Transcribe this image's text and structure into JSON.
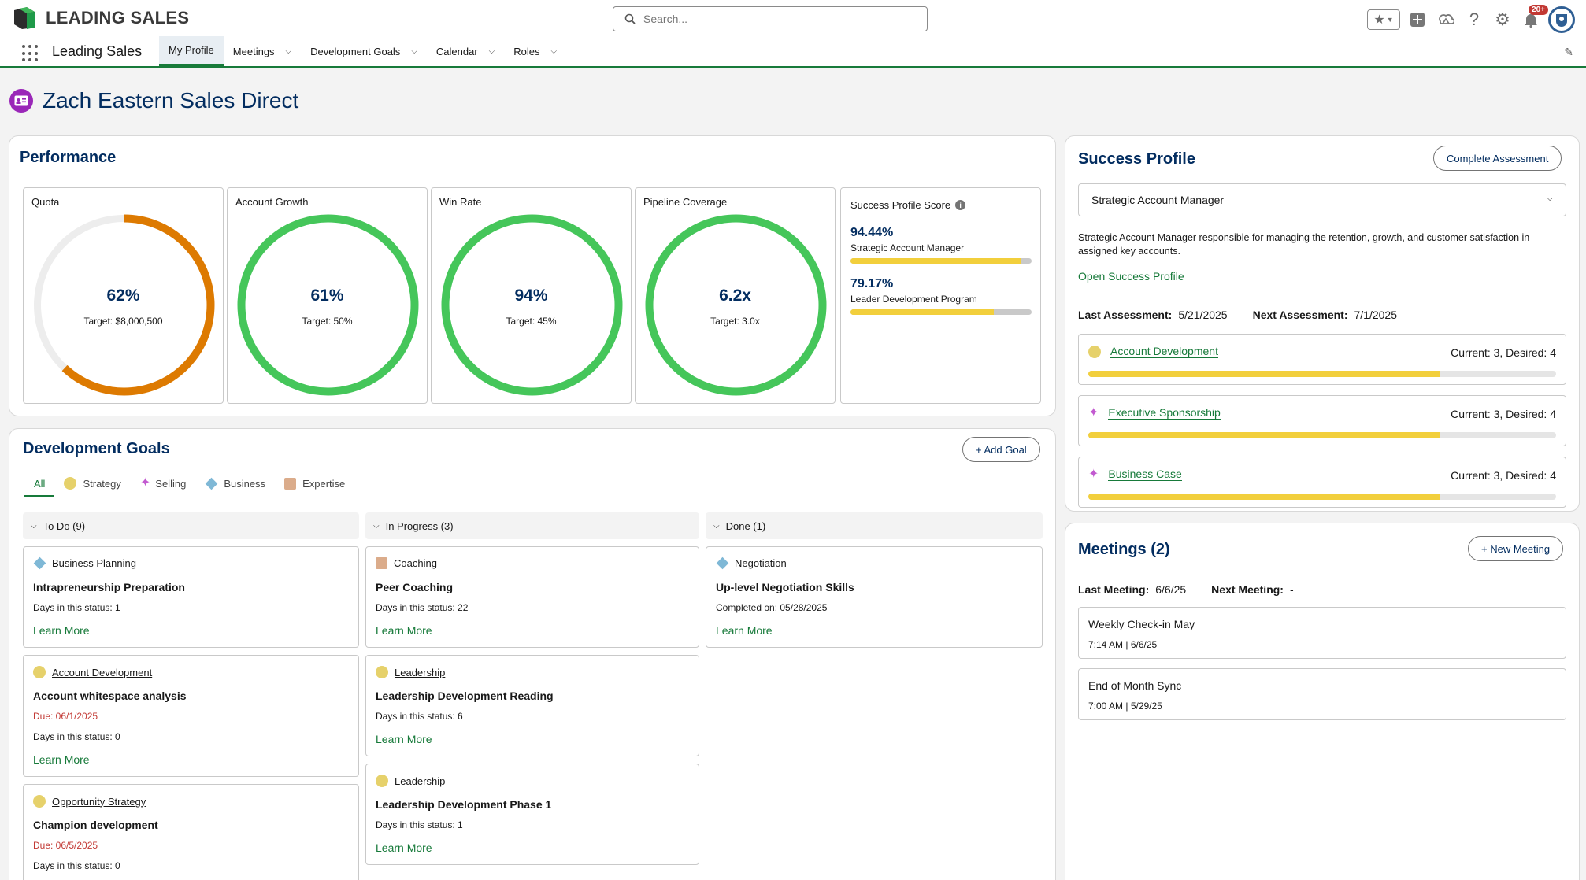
{
  "header": {
    "logo_text": "LEADING SALES",
    "search_placeholder": "Search...",
    "notification_badge": "20+"
  },
  "nav": {
    "app_name": "Leading Sales",
    "items": [
      {
        "label": "My Profile",
        "active": true,
        "has_menu": false
      },
      {
        "label": "Meetings",
        "active": false,
        "has_menu": true
      },
      {
        "label": "Development Goals",
        "active": false,
        "has_menu": true
      },
      {
        "label": "Calendar",
        "active": false,
        "has_menu": true
      },
      {
        "label": "Roles",
        "active": false,
        "has_menu": true
      }
    ]
  },
  "page": {
    "title": "Zach Eastern Sales Direct"
  },
  "performance": {
    "title": "Performance",
    "metrics": [
      {
        "label": "Quota",
        "value": "62%",
        "target": "Target: $8,000,500",
        "progress": 0.62,
        "color": "#dd7a01"
      },
      {
        "label": "Account Growth",
        "value": "61%",
        "target": "Target: 50%",
        "progress": 1.0,
        "color": "#45c65a"
      },
      {
        "label": "Win Rate",
        "value": "94%",
        "target": "Target: 45%",
        "progress": 1.0,
        "color": "#45c65a"
      },
      {
        "label": "Pipeline Coverage",
        "value": "6.2x",
        "target": "Target: 3.0x",
        "progress": 1.0,
        "color": "#45c65a"
      }
    ],
    "success_score": {
      "title": "Success Profile Score",
      "rows": [
        {
          "pct": "94.44%",
          "name": "Strategic Account Manager",
          "fill": 0.9444
        },
        {
          "pct": "79.17%",
          "name": "Leader Development Program",
          "fill": 0.7917
        }
      ]
    }
  },
  "dev_goals": {
    "title": "Development Goals",
    "add_label": "+ Add Goal",
    "filters": [
      "All",
      "Strategy",
      "Selling",
      "Business",
      "Expertise"
    ],
    "columns": [
      {
        "head": "To Do (9)",
        "goals": [
          {
            "category": "Business Planning",
            "icon": "diamond",
            "title": "Intrapreneurship Preparation",
            "due": "",
            "status": "Days in this status: 1",
            "link": "Learn More"
          },
          {
            "category": "Account Development",
            "icon": "dot",
            "title": "Account whitespace analysis",
            "due": "Due: 06/1/2025",
            "status": "Days in this status: 0",
            "link": "Learn More"
          },
          {
            "category": "Opportunity Strategy",
            "icon": "dot",
            "title": "Champion development",
            "due": "Due: 06/5/2025",
            "status": "Days in this status: 0",
            "link": ""
          }
        ]
      },
      {
        "head": "In Progress (3)",
        "goals": [
          {
            "category": "Coaching",
            "icon": "square",
            "title": "Peer Coaching",
            "due": "",
            "status": "Days in this status: 22",
            "link": "Learn More"
          },
          {
            "category": "Leadership",
            "icon": "dot",
            "title": "Leadership Development Reading",
            "due": "",
            "status": "Days in this status: 6",
            "link": "Learn More"
          },
          {
            "category": "Leadership",
            "icon": "dot",
            "title": "Leadership Development Phase 1",
            "due": "",
            "status": "Days in this status: 1",
            "link": "Learn More"
          }
        ]
      },
      {
        "head": "Done (1)",
        "goals": [
          {
            "category": "Negotiation",
            "icon": "diamond",
            "title": "Up-level Negotiation Skills",
            "due": "",
            "status": "Completed on: 05/28/2025",
            "link": "Learn More"
          }
        ]
      }
    ]
  },
  "success_profile": {
    "title": "Success Profile",
    "complete_label": "Complete Assessment",
    "selected": "Strategic Account Manager",
    "description": "Strategic Account Manager responsible for managing the retention, growth, and customer satisfaction in assigned key accounts.",
    "open_link": "Open Success Profile",
    "last_label": "Last Assessment:",
    "last_value": "5/21/2025",
    "next_label": "Next Assessment:",
    "next_value": "7/1/2025",
    "competencies": [
      {
        "name": "Account Development",
        "icon": "dot",
        "stats": "Current: 3, Desired: 4",
        "fill": 0.75
      },
      {
        "name": "Executive Sponsorship",
        "icon": "sparkle",
        "stats": "Current: 3, Desired: 4",
        "fill": 0.75
      },
      {
        "name": "Business Case",
        "icon": "sparkle",
        "stats": "Current: 3, Desired: 4",
        "fill": 0.75
      }
    ]
  },
  "meetings": {
    "title": "Meetings (2)",
    "new_label": "+ New Meeting",
    "last_label": "Last Meeting:",
    "last_value": "6/6/25",
    "next_label": "Next Meeting:",
    "next_value": "-",
    "items": [
      {
        "title": "Weekly Check-in May",
        "time": "7:14 AM | 6/6/25"
      },
      {
        "title": "End of Month Sync",
        "time": "7:00 AM | 5/29/25"
      }
    ]
  }
}
